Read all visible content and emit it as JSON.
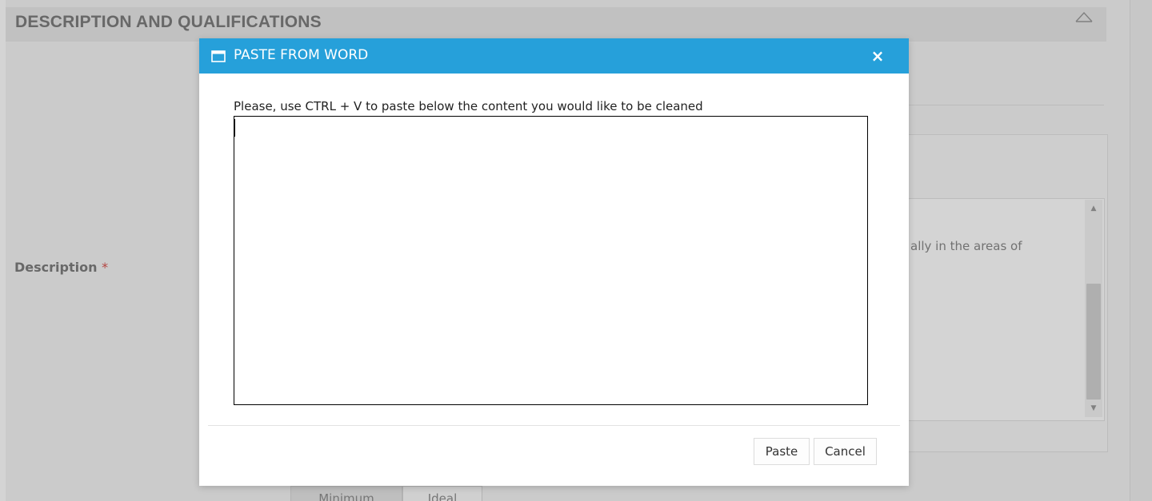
{
  "section": {
    "title": "DESCRIPTION AND QUALIFICATIONS",
    "collapse_icon": "chevron-up-icon"
  },
  "form": {
    "description_label": "Description",
    "required_marker": "*",
    "editor_visible_text": "ally in the areas of"
  },
  "requirement_tabs": [
    {
      "label": "Minimum"
    },
    {
      "label": "Ideal"
    }
  ],
  "modal": {
    "title": "PASTE FROM WORD",
    "title_icon": "window-icon",
    "close_label": "×",
    "instruction": "Please, use CTRL + V to paste below the content you would like to be cleaned",
    "paste_area_value": "",
    "buttons": {
      "paste": "Paste",
      "cancel": "Cancel"
    }
  },
  "colors": {
    "header_blue": "#26a0da",
    "required_red": "#d9534f"
  }
}
